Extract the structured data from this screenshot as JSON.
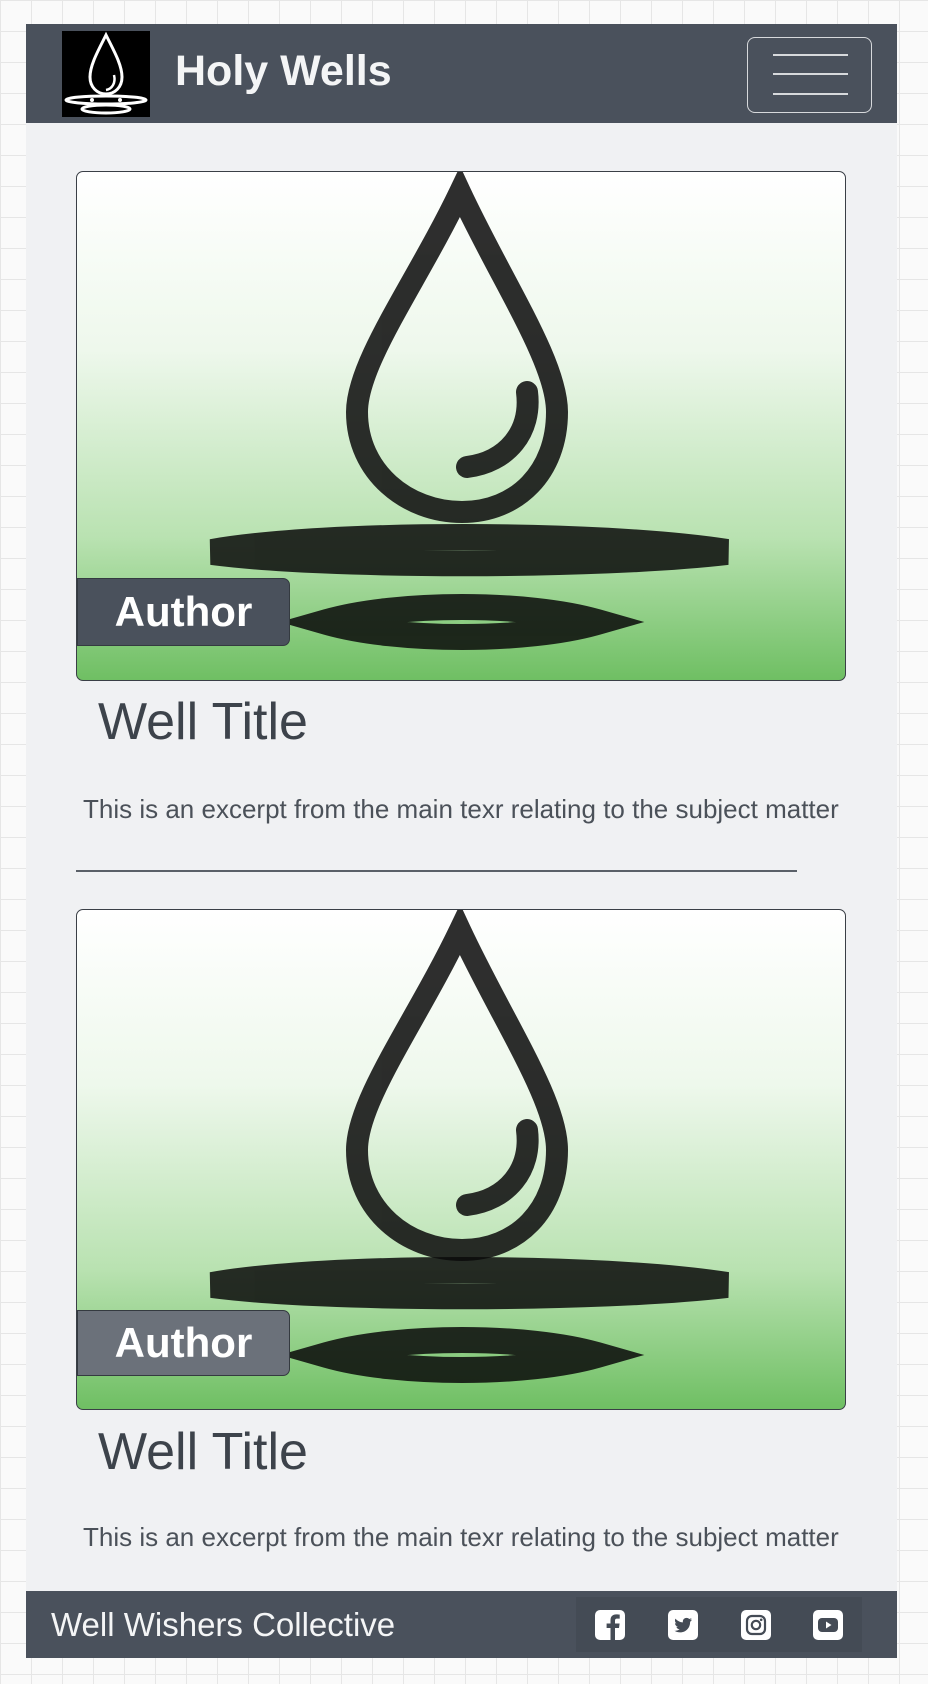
{
  "navbar": {
    "brand_title": "Holy Wells",
    "logo_icon": "water-drop-icon",
    "toggler_icon": "hamburger-menu-icon"
  },
  "cards": [
    {
      "badge": "Author",
      "title": "Well Title",
      "excerpt": "This is an excerpt from the main texr relating to the subject matter",
      "badge_color": "#4a515c"
    },
    {
      "badge": "Author",
      "title": "Well Title",
      "excerpt": "This is an excerpt from the main texr relating to the subject matter",
      "badge_color": "#6b717a"
    }
  ],
  "footer": {
    "text": "Well Wishers Collective",
    "social_icons": [
      "facebook-icon",
      "twitter-icon",
      "instagram-icon",
      "youtube-icon"
    ]
  },
  "colors": {
    "navbar_bg": "#4a515c",
    "page_bg": "#f0f1f3",
    "image_gradient_end": "#6fbf63"
  }
}
